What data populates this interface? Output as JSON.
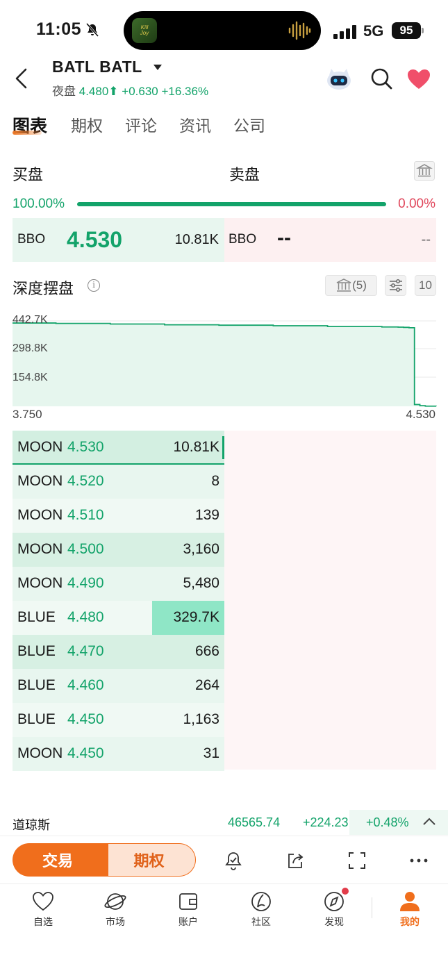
{
  "status_bar": {
    "time": "11:05",
    "network": "5G",
    "battery": "95"
  },
  "header": {
    "title": "BATL  BATL",
    "session_label": "夜盘",
    "price": "4.480",
    "change": "+0.630",
    "change_pct": "+16.36%"
  },
  "tabs": [
    "图表",
    "期权",
    "评论",
    "资讯",
    "公司"
  ],
  "book_header": {
    "bid_label": "买盘",
    "ask_label": "卖盘",
    "bid_pct": "100.00%",
    "ask_pct": "0.00%",
    "bid_fraction": 1.0
  },
  "bbo": {
    "bid_label": "BBO",
    "bid_price": "4.530",
    "bid_size": "10.81K",
    "ask_label": "BBO",
    "ask_price": "--",
    "ask_size": "--"
  },
  "depth": {
    "title": "深度摆盘",
    "info_icon": "i",
    "exchange_count": "(5)",
    "levels": "10"
  },
  "chart_data": {
    "type": "area",
    "x_labels": [
      "3.750",
      "4.530"
    ],
    "y_ticks": [
      "442.7K",
      "298.8K",
      "154.8K"
    ],
    "ylim": [
      10000,
      442700
    ],
    "xlim": [
      3.75,
      4.53
    ],
    "x": [
      3.75,
      3.83,
      3.93,
      4.03,
      4.13,
      4.23,
      4.33,
      4.43,
      4.46,
      4.47,
      4.48,
      4.49,
      4.5,
      4.51,
      4.52,
      4.53
    ],
    "y": [
      432000,
      430000,
      427000,
      423000,
      421000,
      418000,
      414000,
      412000,
      411000,
      410000,
      408000,
      19000,
      13000,
      11000,
      10820,
      10810
    ],
    "color": "#13a36a",
    "fill": "#e6f6ee",
    "grid": true
  },
  "order_book": [
    {
      "mm": "MOON",
      "price": "4.530",
      "size": "10.81K",
      "depth": 0.03,
      "bg": "#d3efe1"
    },
    {
      "mm": "MOON",
      "price": "4.520",
      "size": "8",
      "depth": 0.0,
      "bg": "#e8f6ef"
    },
    {
      "mm": "MOON",
      "price": "4.510",
      "size": "139",
      "depth": 0.0,
      "bg": "#f0f9f4"
    },
    {
      "mm": "MOON",
      "price": "4.500",
      "size": "3,160",
      "depth": 0.0,
      "bg": "#d7f0e3"
    },
    {
      "mm": "MOON",
      "price": "4.490",
      "size": "5,480",
      "depth": 0.0,
      "bg": "#e8f6ef"
    },
    {
      "mm": "BLUE",
      "price": "4.480",
      "size": "329.7K",
      "depth": 1.0,
      "bg": "#f0f9f4"
    },
    {
      "mm": "BLUE",
      "price": "4.470",
      "size": "666",
      "depth": 0.0,
      "bg": "#d7f0e3"
    },
    {
      "mm": "BLUE",
      "price": "4.460",
      "size": "264",
      "depth": 0.0,
      "bg": "#e8f6ef"
    },
    {
      "mm": "BLUE",
      "price": "4.450",
      "size": "1,163",
      "depth": 0.0,
      "bg": "#f0f9f4"
    },
    {
      "mm": "MOON",
      "price": "4.450",
      "size": "31",
      "depth": 0.0,
      "bg": "#e8f6ef"
    }
  ],
  "ticker": {
    "name": "道琼斯",
    "value": "46565.74",
    "change": "+224.23",
    "change_pct": "+0.48%"
  },
  "actions": {
    "trade": "交易",
    "options": "期权"
  },
  "nav": [
    {
      "label": "自选",
      "icon": "heart-outline-icon"
    },
    {
      "label": "市场",
      "icon": "planet-icon"
    },
    {
      "label": "账户",
      "icon": "wallet-icon"
    },
    {
      "label": "社区",
      "icon": "community-icon"
    },
    {
      "label": "发现",
      "icon": "compass-icon"
    },
    {
      "label": "我的",
      "icon": "person-icon"
    }
  ]
}
